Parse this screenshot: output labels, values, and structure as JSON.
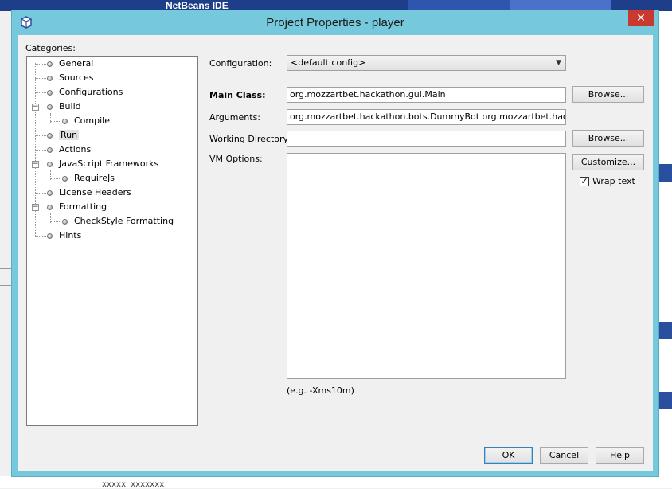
{
  "background": {
    "logo_text": "NetBeans IDE",
    "code_fragment": "xxxxx xxxxxxx"
  },
  "dialog": {
    "title": "Project Properties - player",
    "close_glyph": "✕"
  },
  "categories": {
    "label": "Categories:",
    "items": [
      {
        "label": "General",
        "level": 0
      },
      {
        "label": "Sources",
        "level": 0
      },
      {
        "label": "Configurations",
        "level": 0
      },
      {
        "label": "Build",
        "level": 0,
        "expanded": true
      },
      {
        "label": "Compile",
        "level": 1
      },
      {
        "label": "Run",
        "level": 0,
        "selected": true
      },
      {
        "label": "Actions",
        "level": 0
      },
      {
        "label": "JavaScript Frameworks",
        "level": 0,
        "expanded": true
      },
      {
        "label": "RequireJs",
        "level": 1
      },
      {
        "label": "License Headers",
        "level": 0
      },
      {
        "label": "Formatting",
        "level": 0,
        "expanded": true
      },
      {
        "label": "CheckStyle Formatting",
        "level": 1
      },
      {
        "label": "Hints",
        "level": 0
      }
    ]
  },
  "form": {
    "configuration_label": "Configuration:",
    "configuration_value": "<default config>",
    "main_class_label": "Main Class:",
    "main_class_value": "org.mozzartbet.hackathon.gui.Main",
    "arguments_label": "Arguments:",
    "arguments_value": "org.mozzartbet.hackathon.bots.DummyBot org.mozzartbet.hackathon.b",
    "working_dir_label": "Working Directory:",
    "working_dir_value": "",
    "vm_options_label": "VM Options:",
    "vm_options_value": "",
    "vm_hint": "(e.g. -Xms10m)",
    "browse_label": "Browse...",
    "browse2_label": "Browse...",
    "customize_label": "Customize...",
    "wrap_text_label": "Wrap text",
    "wrap_text_checked": true
  },
  "buttons": {
    "ok": "OK",
    "cancel": "Cancel",
    "help": "Help"
  }
}
